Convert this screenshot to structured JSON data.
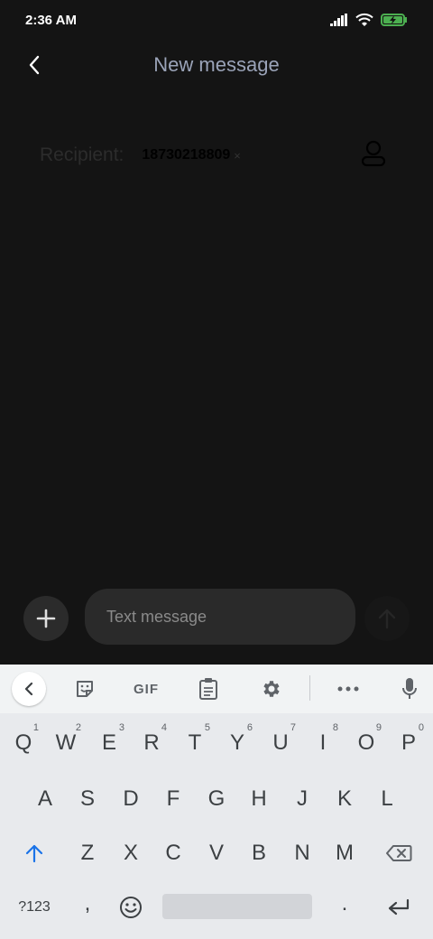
{
  "status_bar": {
    "time": "2:36 AM",
    "battery_color": "#4caf50"
  },
  "header": {
    "title": "New message",
    "back_icon": "chevron-left-icon"
  },
  "recipient": {
    "label": "Recipient:",
    "chip": "18730218809",
    "chip_remove": "×",
    "contact_icon": "person-icon"
  },
  "compose": {
    "placeholder": "Text message",
    "add_icon": "plus-icon",
    "send_icon": "arrow-up-icon"
  },
  "keyboard": {
    "toolbar": {
      "gif_label": "GIF",
      "icons": [
        "chevron-left-icon",
        "sticker-icon",
        "gif-icon",
        "clipboard-icon",
        "gear-icon",
        "more-icon",
        "mic-icon"
      ]
    },
    "row1": [
      {
        "label": "Q",
        "hint": "1"
      },
      {
        "label": "W",
        "hint": "2"
      },
      {
        "label": "E",
        "hint": "3"
      },
      {
        "label": "R",
        "hint": "4"
      },
      {
        "label": "T",
        "hint": "5"
      },
      {
        "label": "Y",
        "hint": "6"
      },
      {
        "label": "U",
        "hint": "7"
      },
      {
        "label": "I",
        "hint": "8"
      },
      {
        "label": "O",
        "hint": "9"
      },
      {
        "label": "P",
        "hint": "0"
      }
    ],
    "row2": [
      "A",
      "S",
      "D",
      "F",
      "G",
      "H",
      "J",
      "K",
      "L"
    ],
    "row3": [
      "Z",
      "X",
      "C",
      "V",
      "B",
      "N",
      "M"
    ],
    "bottom": {
      "symbols": "?123",
      "comma": ",",
      "period": "."
    },
    "accent_color": "#1a73e8"
  }
}
